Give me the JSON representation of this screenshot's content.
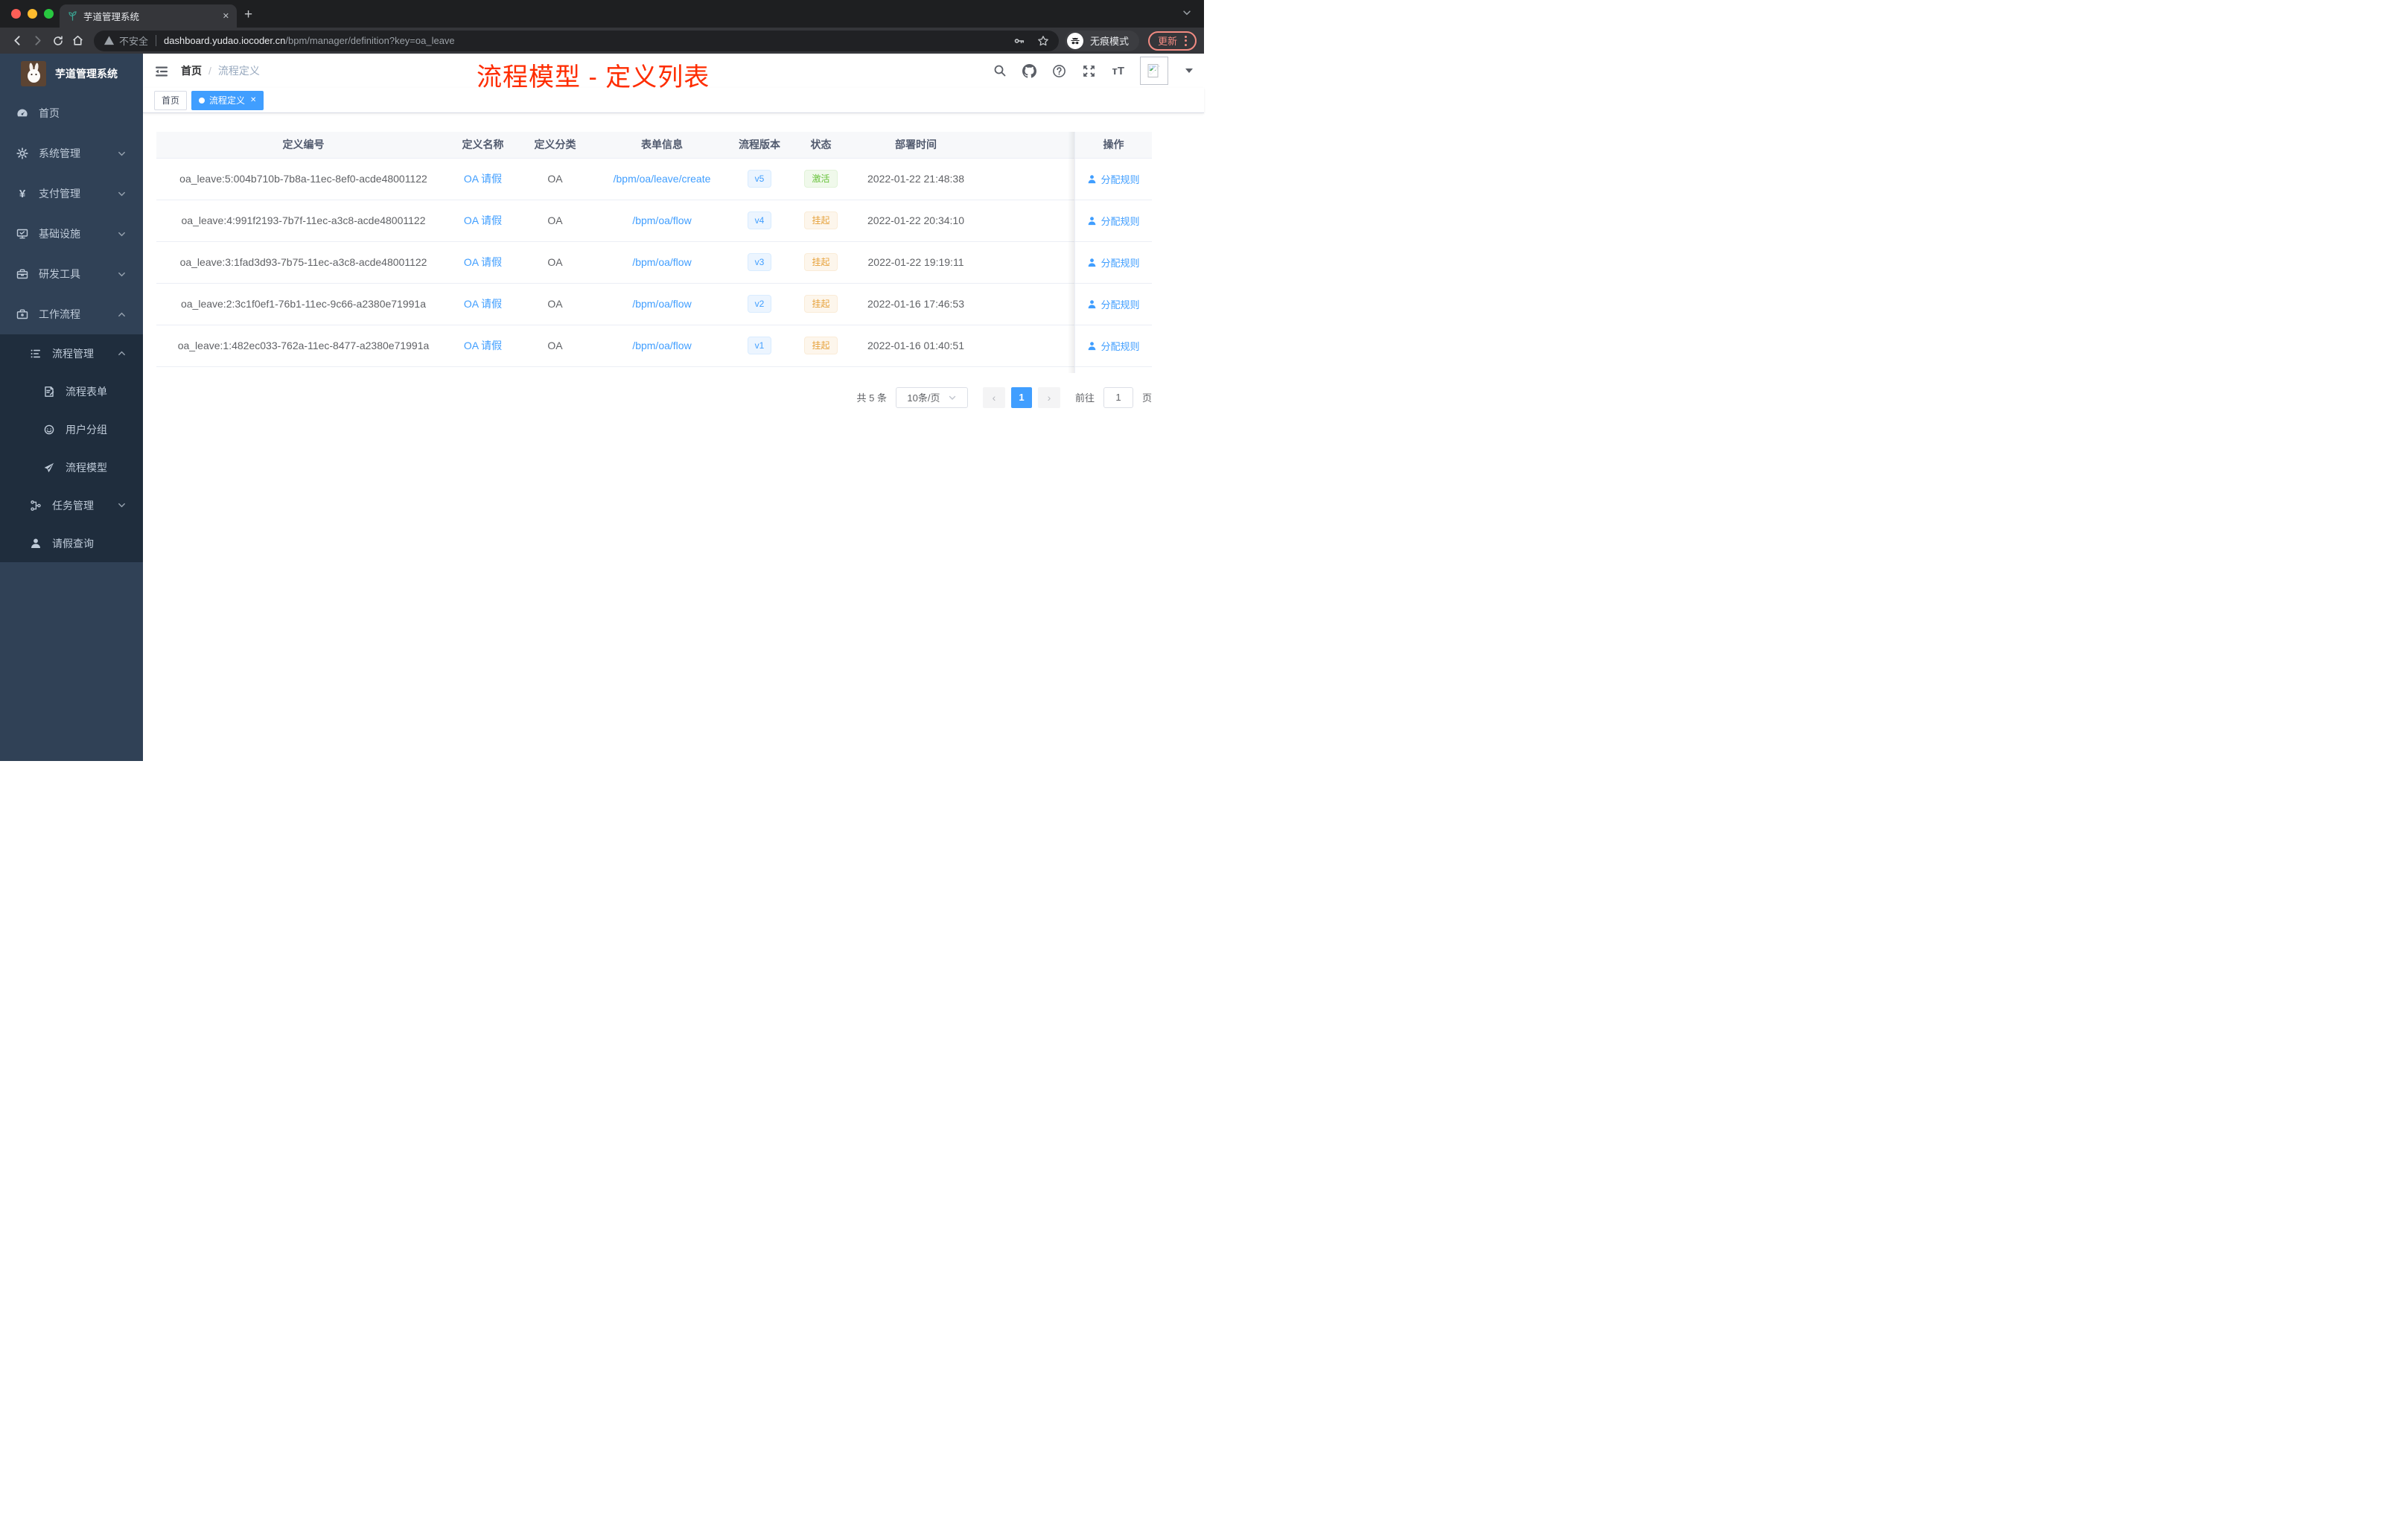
{
  "browser": {
    "tab_title": "芋道管理系统",
    "new_tab_glyph": "+",
    "close_glyph": "✕",
    "security_label": "不安全",
    "url_host": "dashboard.yudao.iocoder.cn",
    "url_path": "/bpm/manager/definition?key=oa_leave",
    "incognito_label": "无痕模式",
    "update_label": "更新"
  },
  "sidebar": {
    "logo_title": "芋道管理系统",
    "items": [
      {
        "label": "首页",
        "icon": "dashboard",
        "level": 1,
        "dark": false,
        "chevron": null
      },
      {
        "label": "系统管理",
        "icon": "gear",
        "level": 1,
        "dark": false,
        "chevron": "down"
      },
      {
        "label": "支付管理",
        "icon": "yen",
        "level": 1,
        "dark": false,
        "chevron": "down"
      },
      {
        "label": "基础设施",
        "icon": "monitor",
        "level": 1,
        "dark": false,
        "chevron": "down"
      },
      {
        "label": "研发工具",
        "icon": "toolbox",
        "level": 1,
        "dark": false,
        "chevron": "down"
      },
      {
        "label": "工作流程",
        "icon": "briefcase",
        "level": 1,
        "dark": false,
        "chevron": "up"
      },
      {
        "label": "流程管理",
        "icon": "list",
        "level": 2,
        "dark": true,
        "chevron": "up"
      },
      {
        "label": "流程表单",
        "icon": "form",
        "level": 3,
        "dark": true,
        "chevron": null
      },
      {
        "label": "用户分组",
        "icon": "people",
        "level": 3,
        "dark": true,
        "chevron": null
      },
      {
        "label": "流程模型",
        "icon": "send",
        "level": 3,
        "dark": true,
        "chevron": null
      },
      {
        "label": "任务管理",
        "icon": "tree",
        "level": 2,
        "dark": true,
        "chevron": "down"
      },
      {
        "label": "请假查询",
        "icon": "user",
        "level": 2,
        "dark": true,
        "chevron": null
      }
    ]
  },
  "header": {
    "breadcrumb_home": "首页",
    "breadcrumb_separator": "/",
    "breadcrumb_current": "流程定义",
    "annotation": "流程模型 - 定义列表"
  },
  "tags": [
    {
      "label": "首页",
      "active": false
    },
    {
      "label": "流程定义",
      "active": true
    }
  ],
  "table": {
    "columns": [
      "定义编号",
      "定义名称",
      "定义分类",
      "表单信息",
      "流程版本",
      "状态",
      "部署时间",
      "操作"
    ],
    "rows": [
      {
        "id": "oa_leave:5:004b710b-7b8a-11ec-8ef0-acde48001122",
        "name": "OA 请假",
        "category": "OA",
        "form": "/bpm/oa/leave/create",
        "version": "v5",
        "status": "激活",
        "status_type": "success",
        "time": "2022-01-22 21:48:38",
        "action": "分配规则"
      },
      {
        "id": "oa_leave:4:991f2193-7b7f-11ec-a3c8-acde48001122",
        "name": "OA 请假",
        "category": "OA",
        "form": "/bpm/oa/flow",
        "version": "v4",
        "status": "挂起",
        "status_type": "warning",
        "time": "2022-01-22 20:34:10",
        "action": "分配规则"
      },
      {
        "id": "oa_leave:3:1fad3d93-7b75-11ec-a3c8-acde48001122",
        "name": "OA 请假",
        "category": "OA",
        "form": "/bpm/oa/flow",
        "version": "v3",
        "status": "挂起",
        "status_type": "warning",
        "time": "2022-01-22 19:19:11",
        "action": "分配规则"
      },
      {
        "id": "oa_leave:2:3c1f0ef1-76b1-11ec-9c66-a2380e71991a",
        "name": "OA 请假",
        "category": "OA",
        "form": "/bpm/oa/flow",
        "version": "v2",
        "status": "挂起",
        "status_type": "warning",
        "time": "2022-01-16 17:46:53",
        "action": "分配规则"
      },
      {
        "id": "oa_leave:1:482ec033-762a-11ec-8477-a2380e71991a",
        "name": "OA 请假",
        "category": "OA",
        "form": "/bpm/oa/flow",
        "version": "v1",
        "status": "挂起",
        "status_type": "warning",
        "time": "2022-01-16 01:40:51",
        "action": "分配规则"
      }
    ]
  },
  "pagination": {
    "total_label": "共 5 条",
    "page_size_label": "10条/页",
    "prev_glyph": "‹",
    "next_glyph": "›",
    "current_page": "1",
    "goto_label": "前往",
    "goto_value": "1",
    "goto_unit": "页"
  },
  "colors": {
    "primary": "#409eff",
    "success": "#67c23a",
    "warning": "#e6a23c",
    "annotation_red": "#fe2c00",
    "sidebar_bg": "#304156",
    "submenu_bg": "#1f2d3d"
  }
}
